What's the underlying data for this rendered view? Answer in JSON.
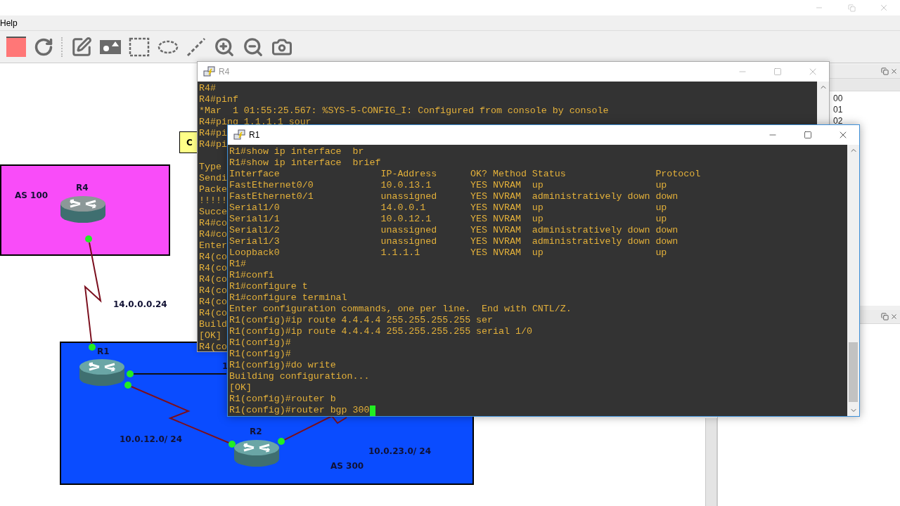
{
  "menu_bar": [
    "Help"
  ],
  "topology": {
    "areas": [
      {
        "label": "AS 100",
        "color": "#f94cf9"
      },
      {
        "label": "AS 300",
        "color": "#0a4cff"
      }
    ],
    "routers": [
      {
        "name": "R4",
        "color": "#8c9898"
      },
      {
        "name": "R1",
        "color": "#6aa6a6"
      },
      {
        "name": "R2",
        "color": "#6aa6a6"
      }
    ],
    "link_labels": [
      "14.0.0.0.24",
      "10.0.12.0/ 24",
      "10.0.23.0/ 24"
    ],
    "hidden_label": "1",
    "note": "C"
  },
  "consoles": [
    {
      "title": "R4",
      "active": false,
      "lines": [
        {
          "kind": "text",
          "text": "R4#"
        },
        {
          "kind": "text",
          "text": "R4#pinf"
        },
        {
          "kind": "text",
          "text": "*Mar  1 01:55:25.567: %SYS-5-CONFIG_I: Configured from console by console"
        },
        {
          "kind": "text",
          "text": "R4#ping 1.1.1.1 sour"
        },
        {
          "kind": "text",
          "text": "R4#pi"
        },
        {
          "kind": "text",
          "text": "R4#pi"
        },
        {
          "kind": "blank"
        },
        {
          "kind": "text",
          "text": "Type"
        },
        {
          "kind": "text",
          "text": "Sendi"
        },
        {
          "kind": "text",
          "text": "Packe"
        },
        {
          "kind": "text",
          "text": "!!!!!"
        },
        {
          "kind": "text",
          "text": "Succe"
        },
        {
          "kind": "text",
          "text": "R4#co"
        },
        {
          "kind": "text",
          "text": "R4#co"
        },
        {
          "kind": "text",
          "text": "Enter"
        },
        {
          "kind": "text",
          "text": "R4(co"
        },
        {
          "kind": "text",
          "text": "R4(co"
        },
        {
          "kind": "text",
          "text": "R4(co"
        },
        {
          "kind": "text",
          "text": "R4(co"
        },
        {
          "kind": "text",
          "text": "R4(co"
        },
        {
          "kind": "text",
          "text": "R4(co"
        },
        {
          "kind": "text",
          "text": "Build"
        },
        {
          "kind": "text",
          "text": "[OK]"
        },
        {
          "kind": "text",
          "text": "R4(co"
        }
      ]
    },
    {
      "title": "R1",
      "active": true,
      "lines": [
        {
          "kind": "text",
          "text": "R1#show ip interface  br"
        },
        {
          "kind": "text",
          "text": "R1#show ip interface  brief"
        },
        {
          "kind": "row",
          "cells": [
            "Interface",
            "IP-Address",
            "OK?",
            "Method",
            "Status",
            "Protocol"
          ]
        },
        {
          "kind": "row",
          "cells": [
            "FastEthernet0/0",
            "10.0.13.1",
            "YES",
            "NVRAM",
            "up",
            "up"
          ]
        },
        {
          "kind": "row",
          "cells": [
            "FastEthernet0/1",
            "unassigned",
            "YES",
            "NVRAM",
            "administratively down",
            "down"
          ]
        },
        {
          "kind": "row",
          "cells": [
            "Serial1/0",
            "14.0.0.1",
            "YES",
            "NVRAM",
            "up",
            "up"
          ]
        },
        {
          "kind": "row",
          "cells": [
            "Serial1/1",
            "10.0.12.1",
            "YES",
            "NVRAM",
            "up",
            "up"
          ]
        },
        {
          "kind": "row",
          "cells": [
            "Serial1/2",
            "unassigned",
            "YES",
            "NVRAM",
            "administratively down",
            "down"
          ]
        },
        {
          "kind": "row",
          "cells": [
            "Serial1/3",
            "unassigned",
            "YES",
            "NVRAM",
            "administratively down",
            "down"
          ]
        },
        {
          "kind": "row",
          "cells": [
            "Loopback0",
            "1.1.1.1",
            "YES",
            "NVRAM",
            "up",
            "up"
          ]
        },
        {
          "kind": "text",
          "text": "R1#"
        },
        {
          "kind": "text",
          "text": "R1#confi"
        },
        {
          "kind": "text",
          "text": "R1#configure t"
        },
        {
          "kind": "text",
          "text": "R1#configure terminal"
        },
        {
          "kind": "text",
          "text": "Enter configuration commands, one per line.  End with CNTL/Z."
        },
        {
          "kind": "text",
          "text": "R1(config)#ip route 4.4.4.4 255.255.255.255 ser"
        },
        {
          "kind": "text",
          "text": "R1(config)#ip route 4.4.4.4 255.255.255.255 serial 1/0"
        },
        {
          "kind": "text",
          "text": "R1(config)#"
        },
        {
          "kind": "text",
          "text": "R1(config)#"
        },
        {
          "kind": "text",
          "text": "R1(config)#do write"
        },
        {
          "kind": "text",
          "text": "Building configuration..."
        },
        {
          "kind": "text",
          "text": "[OK]"
        },
        {
          "kind": "text",
          "text": "R1(config)#router b"
        },
        {
          "kind": "text",
          "text": "R1(config)#router bgp 300",
          "cursor": true
        }
      ]
    }
  ],
  "right_panel": {
    "list_items": [
      "00",
      "01",
      "02"
    ]
  }
}
